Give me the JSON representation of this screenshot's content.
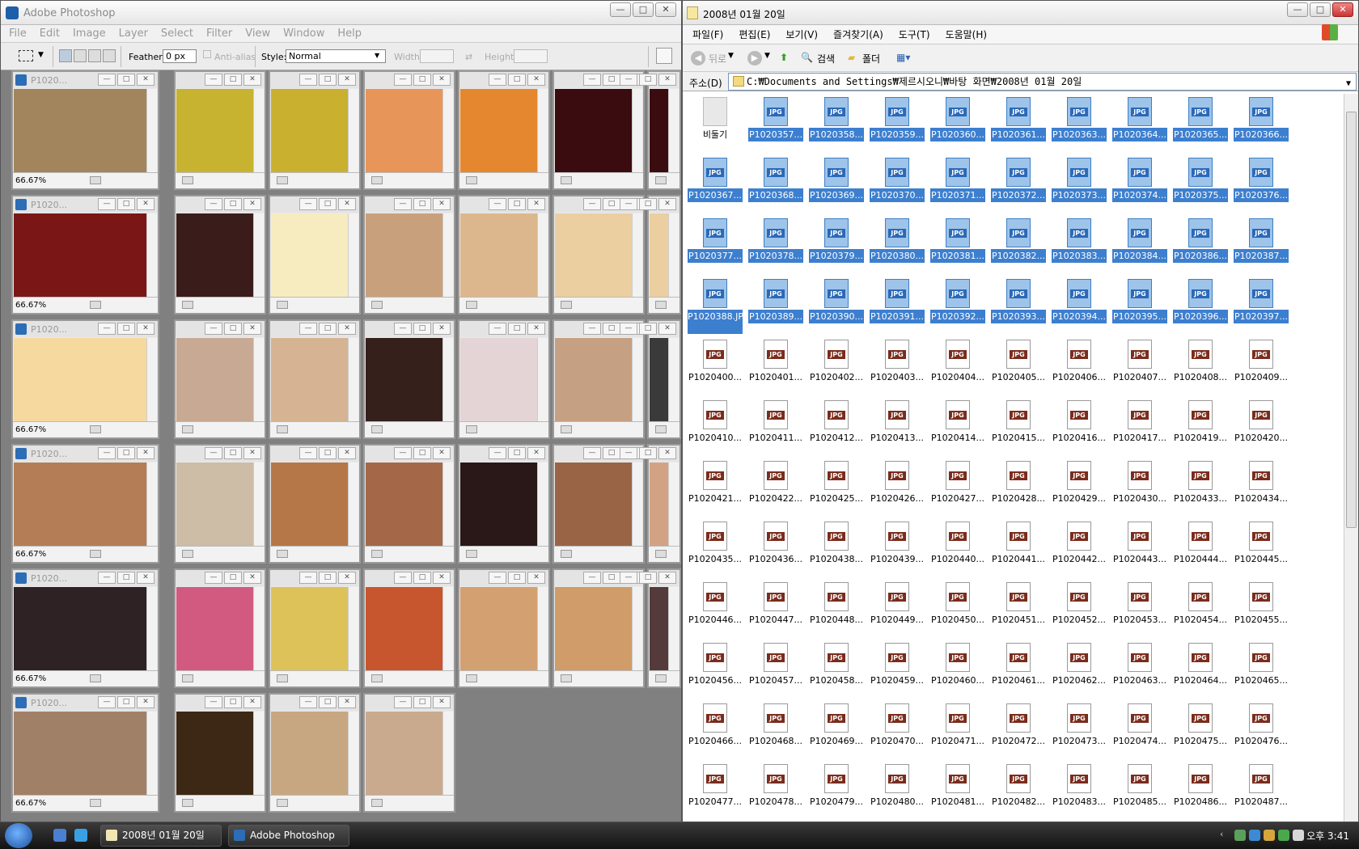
{
  "photoshop": {
    "title": "Adobe Photoshop",
    "menu": [
      "File",
      "Edit",
      "Image",
      "Layer",
      "Select",
      "Filter",
      "View",
      "Window",
      "Help"
    ],
    "options": {
      "feather_label": "Feather:",
      "feather_value": "0 px",
      "antialias_label": "Anti-alias",
      "style_label": "Style:",
      "style_value": "Normal",
      "width_label": "Width:",
      "height_label": "Height:"
    },
    "doc_title": "P1020...",
    "zoom": "66.67%",
    "rows": [
      [
        "#a2855c",
        "#c8b330",
        "#c9b12f",
        "#e8955a",
        "#e5872f",
        "#3a0c10",
        "#3a0c10"
      ],
      [
        "#7a1716",
        "#3a1c1a",
        "#f6ecc0",
        "#c9a07c",
        "#dcb78d",
        "#eccfa0",
        "#eccfa0"
      ],
      [
        "#f6d99f",
        "#c8a994",
        "#d6b392",
        "#35201c",
        "#e4d4d6",
        "#c6a083",
        "#3b3a3a"
      ],
      [
        "#b57d56",
        "#cdbca6",
        "#b57747",
        "#a46848",
        "#2a1718",
        "#996446",
        "#d1a384"
      ],
      [
        "#2f2224",
        "#d25a80",
        "#ddc259",
        "#c7562e",
        "#d3a072",
        "#cf9c6a",
        "#553a3b"
      ],
      [
        "#a18068",
        "#3d2815",
        "#c7a782",
        "#c9aa8e"
      ]
    ]
  },
  "explorer": {
    "title": "2008년 01월 20일",
    "menu": [
      "파일(F)",
      "편집(E)",
      "보기(V)",
      "즐겨찾기(A)",
      "도구(T)",
      "도움말(H)"
    ],
    "toolbar": {
      "back": "뒤로",
      "search": "검색",
      "folders": "폴더"
    },
    "address_label": "주소(D)",
    "address_value": "C:₩Documents and Settings₩제르시오니₩바탕 화면₩2008년 01월 20일",
    "recycle_label": "비둘기",
    "selected_files": [
      "P1020357...",
      "P1020358...",
      "P1020359...",
      "P1020360...",
      "P1020361...",
      "P1020363...",
      "P1020364...",
      "P1020365...",
      "P1020366...",
      "P1020367...",
      "P1020368...",
      "P1020369...",
      "P1020370...",
      "P1020371...",
      "P1020372...",
      "P1020373...",
      "P1020374...",
      "P1020375...",
      "P1020376...",
      "P1020377...",
      "P1020378...",
      "P1020379...",
      "P1020380...",
      "P1020381...",
      "P1020382...",
      "P1020383...",
      "P1020384...",
      "P1020386...",
      "P1020387...",
      "P1020388.JPG",
      "P1020389...",
      "P1020390...",
      "P1020391...",
      "P1020392...",
      "P1020393...",
      "P1020394...",
      "P1020395...",
      "P1020396...",
      "P1020397..."
    ],
    "files": [
      "P1020400...",
      "P1020401...",
      "P1020402...",
      "P1020403...",
      "P1020404...",
      "P1020405...",
      "P1020406...",
      "P1020407...",
      "P1020408...",
      "P1020409...",
      "P1020410...",
      "P1020411...",
      "P1020412...",
      "P1020413...",
      "P1020414...",
      "P1020415...",
      "P1020416...",
      "P1020417...",
      "P1020419...",
      "P1020420...",
      "P1020421...",
      "P1020422...",
      "P1020425...",
      "P1020426...",
      "P1020427...",
      "P1020428...",
      "P1020429...",
      "P1020430...",
      "P1020433...",
      "P1020434...",
      "P1020435...",
      "P1020436...",
      "P1020438...",
      "P1020439...",
      "P1020440...",
      "P1020441...",
      "P1020442...",
      "P1020443...",
      "P1020444...",
      "P1020445...",
      "P1020446...",
      "P1020447...",
      "P1020448...",
      "P1020449...",
      "P1020450...",
      "P1020451...",
      "P1020452...",
      "P1020453...",
      "P1020454...",
      "P1020455...",
      "P1020456...",
      "P1020457...",
      "P1020458...",
      "P1020459...",
      "P1020460...",
      "P1020461...",
      "P1020462...",
      "P1020463...",
      "P1020464...",
      "P1020465...",
      "P1020466...",
      "P1020468...",
      "P1020469...",
      "P1020470...",
      "P1020471...",
      "P1020472...",
      "P1020473...",
      "P1020474...",
      "P1020475...",
      "P1020476...",
      "P1020477...",
      "P1020478...",
      "P1020479...",
      "P1020480...",
      "P1020481...",
      "P1020482...",
      "P1020483...",
      "P1020485...",
      "P1020486...",
      "P1020487..."
    ],
    "file_badge": "JPG"
  },
  "taskbar": {
    "explorer_button": "2008년 01월 20일",
    "photoshop_button": "Adobe Photoshop",
    "clock": "오후 3:41"
  },
  "colors": {
    "selection": "#3d7fcf",
    "jpg_badge": "#7a2c1c",
    "taskbar": "#1e1e1e"
  }
}
